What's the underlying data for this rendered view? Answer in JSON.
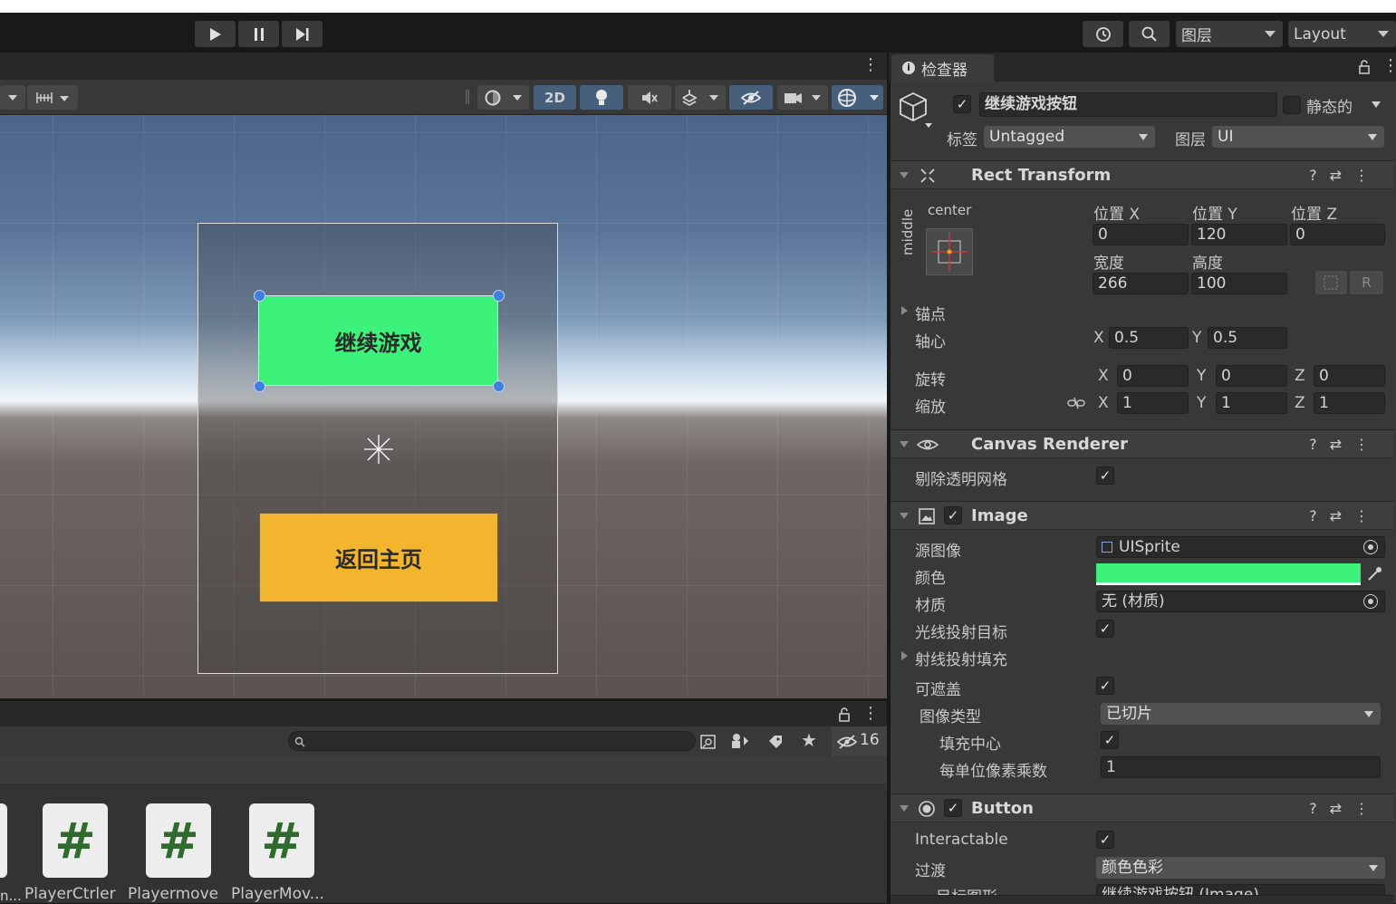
{
  "toolbar": {
    "play_icon": "play-icon",
    "pause_icon": "pause-icon",
    "step_icon": "step-icon",
    "layers_dropdown": "图层",
    "layout_dropdown": "Layout"
  },
  "scene": {
    "mode_2d": "2D",
    "buttons": [
      {
        "label": "继续游戏",
        "color": "#3cf27a"
      },
      {
        "label": "返回主页",
        "color": "#f3b52e"
      }
    ]
  },
  "project": {
    "hidden_count": "16",
    "files": [
      {
        "name": "PlayerCtrler"
      },
      {
        "name": "Playermove"
      },
      {
        "name": "PlayerMov..."
      }
    ],
    "partial_file": "n..."
  },
  "inspector": {
    "tab_label": "检查器",
    "object_name": "继续游戏按钮",
    "static_label": "静态的",
    "tag_label": "标签",
    "tag_value": "Untagged",
    "layer_label": "图层",
    "layer_value": "UI",
    "rect_transform": {
      "title": "Rect Transform",
      "anchor_h": "center",
      "anchor_v": "middle",
      "pos_x_label": "位置 X",
      "pos_y_label": "位置 Y",
      "pos_z_label": "位置 Z",
      "pos_x": "0",
      "pos_y": "120",
      "pos_z": "0",
      "width_label": "宽度",
      "height_label": "高度",
      "width": "266",
      "height": "100",
      "anchors_label": "锚点",
      "pivot_label": "轴心",
      "pivot_x": "0.5",
      "pivot_y": "0.5",
      "rotation_label": "旋转",
      "rot_x": "0",
      "rot_y": "0",
      "rot_z": "0",
      "scale_label": "缩放",
      "scale_x": "1",
      "scale_y": "1",
      "scale_z": "1",
      "axis_x": "X",
      "axis_y": "Y",
      "axis_z": "Z",
      "r_button": "R"
    },
    "canvas_renderer": {
      "title": "Canvas Renderer",
      "cull_label": "剔除透明网格"
    },
    "image": {
      "title": "Image",
      "source_label": "源图像",
      "source_value": "UISprite",
      "color_label": "颜色",
      "color_value": "#3cf27a",
      "material_label": "材质",
      "material_value": "无 (材质)",
      "raycast_target_label": "光线投射目标",
      "raycast_padding_label": "射线投射填充",
      "maskable_label": "可遮盖",
      "image_type_label": "图像类型",
      "image_type_value": "已切片",
      "fill_center_label": "填充中心",
      "ppu_label": "每单位像素乘数",
      "ppu_value": "1"
    },
    "button": {
      "title": "Button",
      "interactable_label": "Interactable",
      "transition_label": "过渡",
      "transition_value": "颜色色彩",
      "target_graphic_label": "目标图形",
      "target_graphic_value": "继续游戏按钮 (Image)"
    }
  }
}
